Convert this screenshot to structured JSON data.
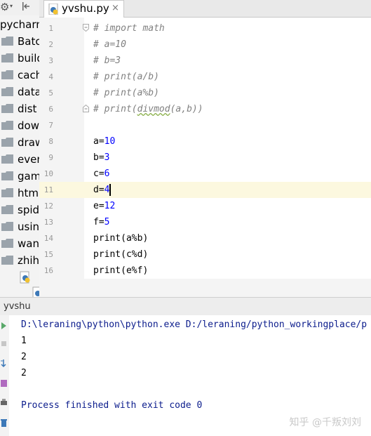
{
  "sidebar": {
    "root_label": "pycharm",
    "items": [
      {
        "label": "Batc"
      },
      {
        "label": "build"
      },
      {
        "label": "cach"
      },
      {
        "label": "data"
      },
      {
        "label": "dist"
      },
      {
        "label": "dow"
      },
      {
        "label": "draw"
      },
      {
        "label": "ever"
      },
      {
        "label": "gam"
      },
      {
        "label": "htm"
      },
      {
        "label": "spid"
      },
      {
        "label": "usin"
      },
      {
        "label": "wan"
      },
      {
        "label": "zhih"
      }
    ],
    "icons": {
      "settings": "gear-icon",
      "collapse": "collapse-icon",
      "folder": "folder-icon",
      "python_file": "python-file-icon"
    }
  },
  "editor": {
    "tab": {
      "label": "yvshu.py",
      "close": "×"
    },
    "lines": [
      {
        "num": "1",
        "text": "# import math"
      },
      {
        "num": "2",
        "text": "# a=10"
      },
      {
        "num": "3",
        "text": "# b=3"
      },
      {
        "num": "4",
        "text": "# print(a/b)"
      },
      {
        "num": "5",
        "text": "# print(a%b)"
      },
      {
        "num": "6a",
        "text": "# print("
      },
      {
        "num": "7",
        "text": ""
      },
      {
        "num": "8",
        "text": "a="
      },
      {
        "num": "9",
        "text": "b="
      },
      {
        "num": "10",
        "text": "c="
      },
      {
        "num": "11",
        "text": "d="
      },
      {
        "num": "12",
        "text": "e="
      },
      {
        "num": "13",
        "text": "f="
      },
      {
        "num": "14",
        "text": "print(a%b)"
      },
      {
        "num": "15",
        "text": "print(c%d)"
      },
      {
        "num": "16",
        "text": "print(e%f)"
      }
    ],
    "line6": {
      "num": "6",
      "prefix": "# print(",
      "underlined": "divmod",
      "suffix": "(a,b))"
    },
    "numbers": {
      "8": "10",
      "9": "3",
      "10": "6",
      "11": "4",
      "12": "12",
      "13": "5"
    },
    "current_line": "11"
  },
  "run": {
    "title": "yvshu",
    "output": [
      "D:\\leraning\\python\\python.exe D:/leraning/python_workingplace/p",
      "1",
      "2",
      "2",
      "",
      "Process finished with exit code 0"
    ],
    "icons": [
      "rerun-icon",
      "stop-icon",
      "scroll-icon",
      "debug-icon",
      "print-icon",
      "trash-icon"
    ]
  },
  "watermark": "知乎 @千叛刘刘",
  "colors": {
    "comment": "#808080",
    "number": "#0000ff",
    "current_line": "#fcf8df",
    "console_blue": "#0b1c8c"
  }
}
